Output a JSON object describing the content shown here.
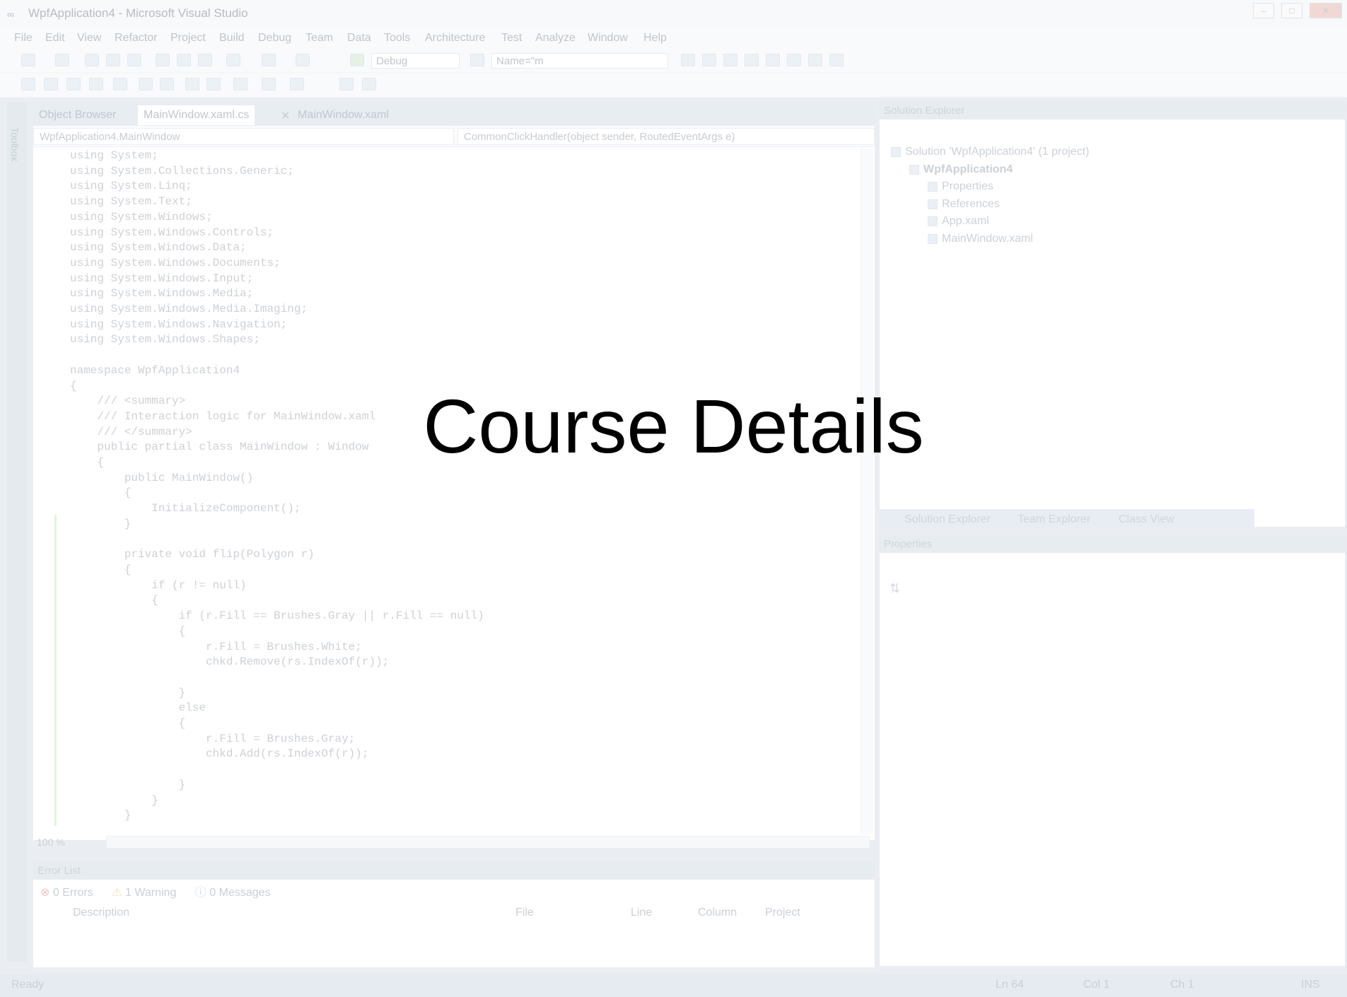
{
  "window": {
    "title": "WpfApplication4 - Microsoft Visual Studio"
  },
  "menu": [
    "File",
    "Edit",
    "View",
    "Refactor",
    "Project",
    "Build",
    "Debug",
    "Team",
    "Data",
    "Tools",
    "Architecture",
    "Test",
    "Analyze",
    "Window",
    "Help"
  ],
  "toolbar": {
    "config": "Debug",
    "find": "Name=\"m"
  },
  "tabs": [
    "Object Browser",
    "MainWindow.xaml.cs",
    "MainWindow.xaml"
  ],
  "toolbox_label": "Toolbox",
  "nav": {
    "type": "WpfApplication4.MainWindow",
    "member": "CommonClickHandler(object sender, RoutedEventArgs e)"
  },
  "code": [
    "using System;",
    "using System.Collections.Generic;",
    "using System.Linq;",
    "using System.Text;",
    "using System.Windows;",
    "using System.Windows.Controls;",
    "using System.Windows.Data;",
    "using System.Windows.Documents;",
    "using System.Windows.Input;",
    "using System.Windows.Media;",
    "using System.Windows.Media.Imaging;",
    "using System.Windows.Navigation;",
    "using System.Windows.Shapes;",
    "",
    "namespace WpfApplication4",
    "{",
    "    /// <summary>",
    "    /// Interaction logic for MainWindow.xaml",
    "    /// </summary>",
    "    public partial class MainWindow : Window",
    "    {",
    "        public MainWindow()",
    "        {",
    "            InitializeComponent();",
    "        }",
    "",
    "        private void flip(Polygon r)",
    "        {",
    "            if (r != null)",
    "            {",
    "                if (r.Fill == Brushes.Gray || r.Fill == null)",
    "                {",
    "                    r.Fill = Brushes.White;",
    "                    chkd.Remove(rs.IndexOf(r));",
    "",
    "                }",
    "                else",
    "                {",
    "                    r.Fill = Brushes.Gray;",
    "                    chkd.Add(rs.IndexOf(r));",
    "",
    "                }",
    "            }",
    "        }"
  ],
  "zoom": "100 %",
  "error_list": {
    "title": "Error List",
    "errors": "0 Errors",
    "warnings": "1 Warning",
    "messages": "0 Messages",
    "columns": [
      "Description",
      "File",
      "Line",
      "Column",
      "Project"
    ]
  },
  "solution_explorer": {
    "title": "Solution Explorer",
    "solution": "Solution 'WpfApplication4' (1 project)",
    "project": "WpfApplication4",
    "items": [
      "Properties",
      "References",
      "App.xaml",
      "MainWindow.xaml"
    ],
    "bottom_tabs": [
      "Solution Explorer",
      "Team Explorer",
      "Class View"
    ]
  },
  "properties": {
    "title": "Properties"
  },
  "status": {
    "ready": "Ready",
    "ln": "Ln 64",
    "col": "Col 1",
    "ch": "Ch 1",
    "ins": "INS"
  },
  "overlay_title": "Course Details"
}
